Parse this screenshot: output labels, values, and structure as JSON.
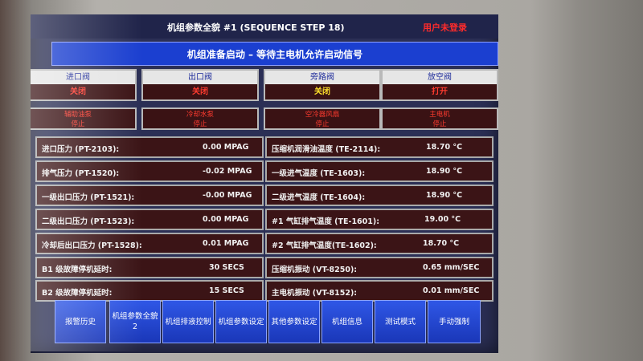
{
  "header": {
    "title": "机组参数全貌 #1 (SEQUENCE STEP  18)",
    "login_status": "用户未登录"
  },
  "status_message": "机组准备启动 – 等待主电机允许启动信号",
  "valves": [
    {
      "name": "进口阀",
      "state": "关闭"
    },
    {
      "name": "出口阀",
      "state": "关闭"
    },
    {
      "name": "旁路阀",
      "state": "关闭"
    },
    {
      "name": "放空阀",
      "state": "打开"
    }
  ],
  "pumps": [
    {
      "name": "辅助油泵",
      "state": "停止"
    },
    {
      "name": "冷却水泵",
      "state": "停止"
    },
    {
      "name": "空冷器风扇",
      "state": "停止"
    },
    {
      "name": "主电机",
      "state": "停止"
    }
  ],
  "left_params": [
    {
      "label": "进口压力 (PT-2103):",
      "value": "0.00 MPAG"
    },
    {
      "label": "排气压力 (PT-1520):",
      "value": "-0.02 MPAG"
    },
    {
      "label": "一级出口压力 (PT-1521):",
      "value": "-0.00 MPAG"
    },
    {
      "label": "二级出口压力 (PT-1523):",
      "value": "0.00 MPAG"
    },
    {
      "label": "冷却后出口压力 (PT-1528):",
      "value": "0.01 MPAG"
    },
    {
      "label": "B1 级故障停机延时:",
      "value": "30 SECS"
    },
    {
      "label": "B2 级故障停机延时:",
      "value": "15 SECS"
    }
  ],
  "right_params": [
    {
      "label": "压缩机润滑油温度 (TE-2114):",
      "value": "18.70 °C"
    },
    {
      "label": "一级进气温度 (TE-1603):",
      "value": "18.90 °C"
    },
    {
      "label": "二级进气温度 (TE-1604):",
      "value": "18.90 °C"
    },
    {
      "label": "#1 气缸排气温度 (TE-1601):",
      "value": "19.00 °C"
    },
    {
      "label": "#2 气缸排气温度(TE-1602):",
      "value": "18.70 °C"
    },
    {
      "label": "压缩机振动 (VT-8250):",
      "value": "0.65 mm/SEC"
    },
    {
      "label": "主电机振动 (VT-8152):",
      "value": "0.01 mm/SEC"
    }
  ],
  "nav_buttons": [
    {
      "label": "报警历史"
    },
    {
      "label": "机组参数全貌 2"
    },
    {
      "label": "机组排液控制"
    },
    {
      "label": "机组参数设定"
    },
    {
      "label": "其他参数设定"
    },
    {
      "label": "机组信息"
    },
    {
      "label": "测试模式"
    },
    {
      "label": "手动强制"
    }
  ]
}
